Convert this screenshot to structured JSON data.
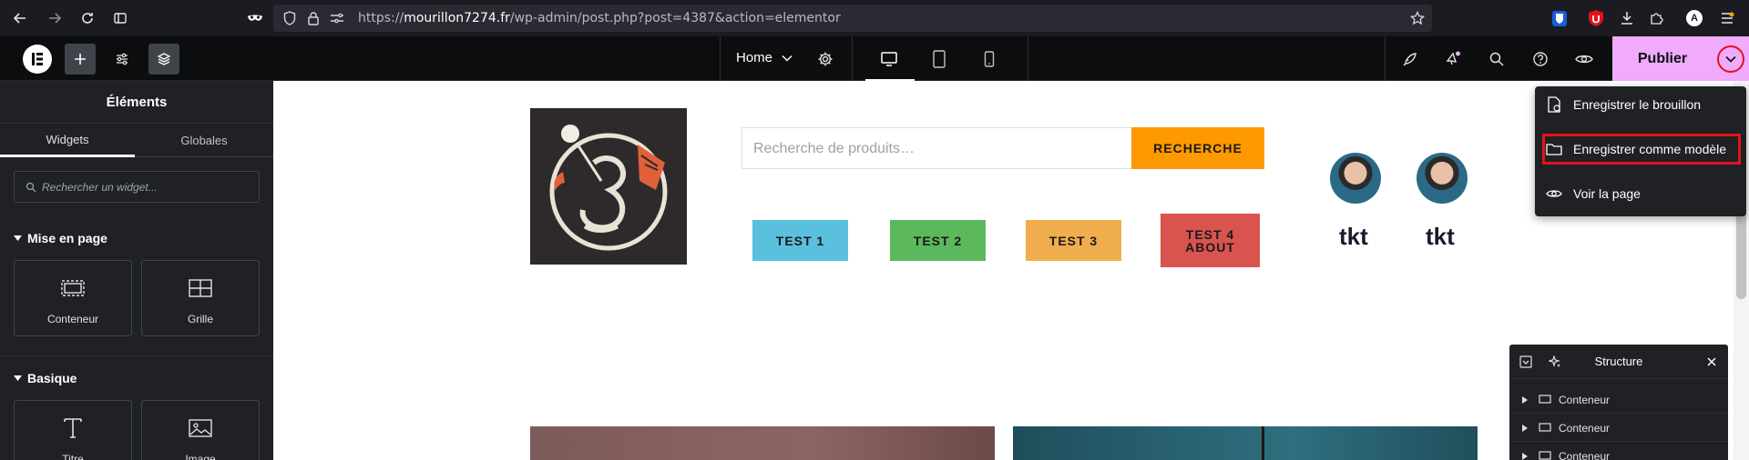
{
  "browser": {
    "url_host": "mourillon7274.fr",
    "url_path": "/wp-admin/post.php?post=4387&action=elementor",
    "url_scheme": "https://",
    "extension_avatar_letter": "A"
  },
  "topbar": {
    "page_name": "Home",
    "publish_label": "Publier",
    "accent_color": "#f0abfc"
  },
  "left_panel": {
    "title": "Éléments",
    "tabs": [
      {
        "label": "Widgets"
      },
      {
        "label": "Globales"
      }
    ],
    "search_placeholder": "Rechercher un widget...",
    "sections": [
      {
        "title": "Mise en page",
        "widgets": [
          {
            "label": "Conteneur",
            "icon": "container-icon"
          },
          {
            "label": "Grille",
            "icon": "grid-icon"
          }
        ]
      },
      {
        "title": "Basique",
        "widgets": [
          {
            "label": "Titre",
            "icon": "title-icon"
          },
          {
            "label": "Image",
            "icon": "image-icon"
          }
        ]
      }
    ]
  },
  "canvas": {
    "search_placeholder": "Recherche de produits…",
    "search_button": "RECHERCHE",
    "nav_buttons": [
      {
        "label": "TEST 1",
        "color": "#5bc0de"
      },
      {
        "label": "TEST 2",
        "color": "#5cb85c"
      },
      {
        "label": "TEST 3",
        "color": "#f0ad4e"
      },
      {
        "label": "TEST 4 ABOUT",
        "color": "#d9534f"
      }
    ],
    "avatars": [
      {
        "label": "tkt"
      },
      {
        "label": "tkt"
      }
    ]
  },
  "publish_menu": {
    "items": [
      {
        "label": "Enregistrer le brouillon",
        "icon": "draft-icon"
      },
      {
        "label": "Enregistrer comme modèle",
        "icon": "folder-icon"
      },
      {
        "label": "Voir la page",
        "icon": "eye-icon"
      }
    ]
  },
  "structure_panel": {
    "title": "Structure",
    "rows": [
      {
        "label": "Conteneur"
      },
      {
        "label": "Conteneur"
      },
      {
        "label": "Conteneur"
      }
    ]
  }
}
